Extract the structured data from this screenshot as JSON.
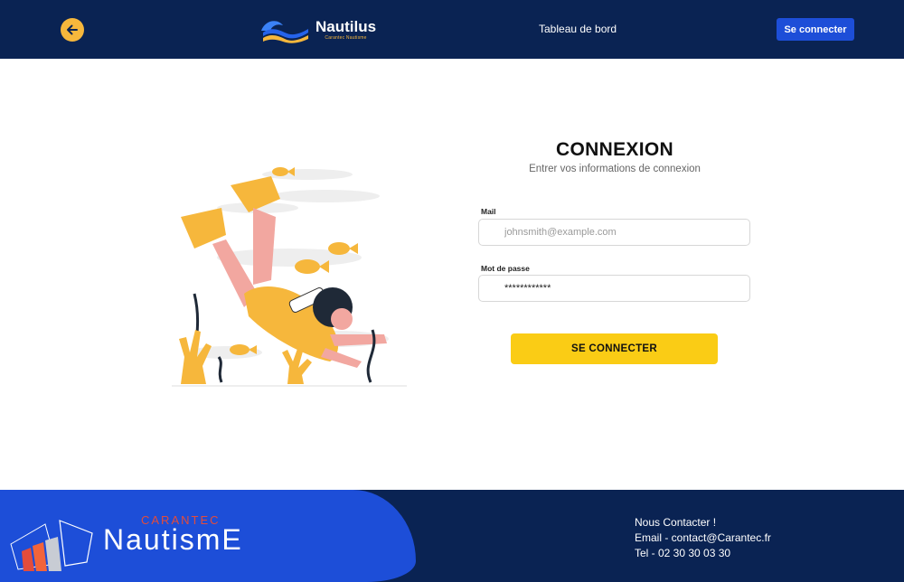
{
  "header": {
    "brand_name": "Nautilus",
    "brand_tagline": "Carantec Nautisme",
    "nav_dashboard": "Tableau de bord",
    "login_button": "Se connecter"
  },
  "login": {
    "title": "CONNEXION",
    "subtitle": "Entrer vos informations de connexion",
    "mail_label": "Mail",
    "mail_placeholder": "johnsmith@example.com",
    "password_label": "Mot de passe",
    "password_value": "************",
    "submit_label": "SE CONNECTER"
  },
  "footer": {
    "logo_top": "CARANTEC",
    "logo_main": "NautismE",
    "contact_title": "Nous Contacter !",
    "contact_email": "Email - contact@Carantec.fr",
    "contact_phone": "Tel - 02 30 30 03 30"
  },
  "colors": {
    "navy": "#0a2353",
    "blue": "#1d4ed8",
    "yellow": "#facc15",
    "orange": "#f6b73c"
  }
}
